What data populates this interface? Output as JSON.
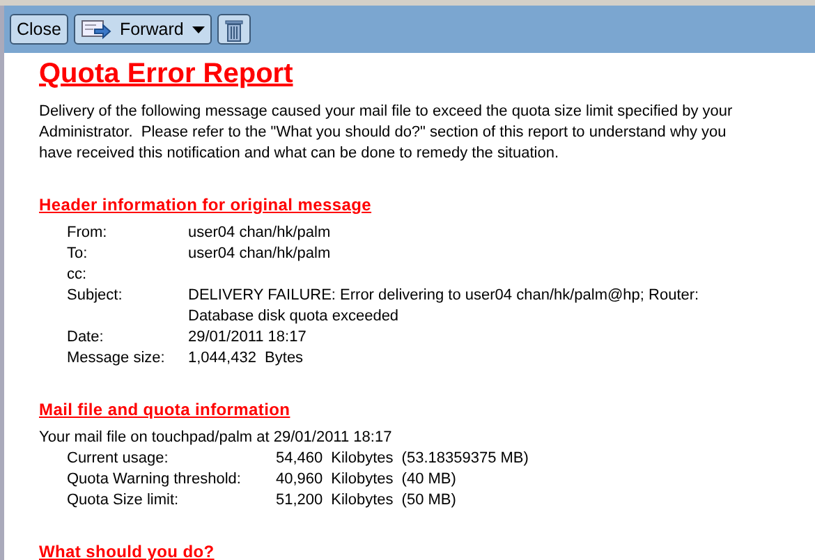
{
  "toolbar": {
    "buttons": [
      {
        "kind": "text",
        "label": "Close"
      },
      {
        "kind": "dropdown",
        "label": "Forward"
      },
      {
        "kind": "icon"
      }
    ]
  },
  "report": {
    "title": "Quota Error Report",
    "intro": "Delivery of the following message caused your mail file to exceed the quota size limit specified by your Administrator.  Please refer to the \"What you should do?\" section of this report to understand why you have received this notification and what can be done to remedy the situation.",
    "header_section": {
      "heading": "Header information for original message",
      "fields": [
        {
          "label": "From:",
          "value": "user04 chan/hk/palm"
        },
        {
          "label": "To:",
          "value": "user04 chan/hk/palm"
        },
        {
          "label": "cc:"
        },
        {
          "label": "Subject:",
          "value": "DELIVERY FAILURE: Error delivering to user04 chan/hk/palm@hp; Router: Database disk quota exceeded"
        },
        {
          "label": "Date:",
          "value": "29/01/2011 18:17"
        },
        {
          "label": "Message size:",
          "value": "1,044,432  Bytes"
        }
      ]
    },
    "quota_section": {
      "heading": "Mail file and quota information",
      "summary": "Your mail file on touchpad/palm at 29/01/2011 18:17",
      "rows": [
        {
          "label": "Current usage:",
          "amount": "54,460",
          "unit": "Kilobytes",
          "note": "(53.18359375 MB)"
        },
        {
          "label": "Quota Warning threshold:",
          "amount": "40,960",
          "unit": "Kilobytes",
          "note": "(40 MB)"
        },
        {
          "label": "Quota Size limit:",
          "amount": "51,200",
          "unit": "Kilobytes",
          "note": "(50 MB)"
        }
      ]
    },
    "next_heading": "What should you do?"
  }
}
